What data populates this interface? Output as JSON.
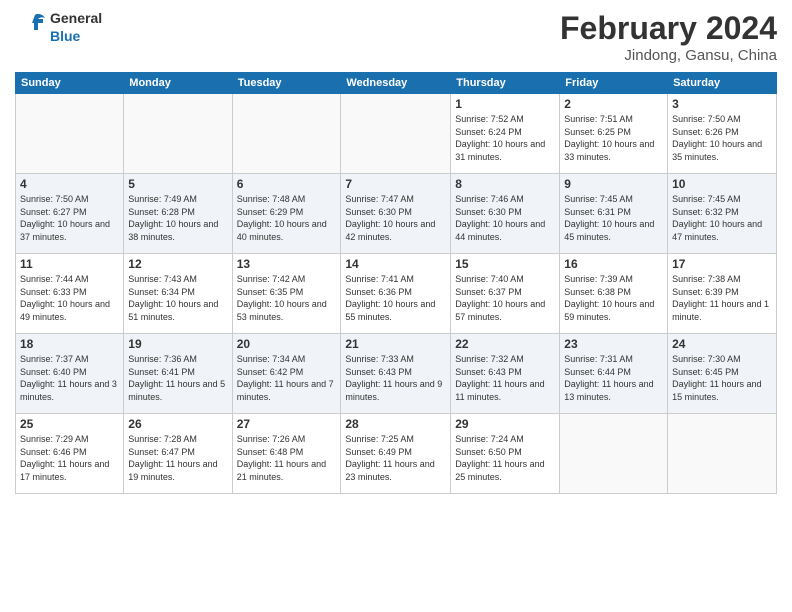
{
  "header": {
    "logo_line1": "General",
    "logo_line2": "Blue",
    "month_year": "February 2024",
    "location": "Jindong, Gansu, China"
  },
  "days_of_week": [
    "Sunday",
    "Monday",
    "Tuesday",
    "Wednesday",
    "Thursday",
    "Friday",
    "Saturday"
  ],
  "weeks": [
    [
      {
        "day": "",
        "info": ""
      },
      {
        "day": "",
        "info": ""
      },
      {
        "day": "",
        "info": ""
      },
      {
        "day": "",
        "info": ""
      },
      {
        "day": "1",
        "info": "Sunrise: 7:52 AM\nSunset: 6:24 PM\nDaylight: 10 hours and 31 minutes."
      },
      {
        "day": "2",
        "info": "Sunrise: 7:51 AM\nSunset: 6:25 PM\nDaylight: 10 hours and 33 minutes."
      },
      {
        "day": "3",
        "info": "Sunrise: 7:50 AM\nSunset: 6:26 PM\nDaylight: 10 hours and 35 minutes."
      }
    ],
    [
      {
        "day": "4",
        "info": "Sunrise: 7:50 AM\nSunset: 6:27 PM\nDaylight: 10 hours and 37 minutes."
      },
      {
        "day": "5",
        "info": "Sunrise: 7:49 AM\nSunset: 6:28 PM\nDaylight: 10 hours and 38 minutes."
      },
      {
        "day": "6",
        "info": "Sunrise: 7:48 AM\nSunset: 6:29 PM\nDaylight: 10 hours and 40 minutes."
      },
      {
        "day": "7",
        "info": "Sunrise: 7:47 AM\nSunset: 6:30 PM\nDaylight: 10 hours and 42 minutes."
      },
      {
        "day": "8",
        "info": "Sunrise: 7:46 AM\nSunset: 6:30 PM\nDaylight: 10 hours and 44 minutes."
      },
      {
        "day": "9",
        "info": "Sunrise: 7:45 AM\nSunset: 6:31 PM\nDaylight: 10 hours and 45 minutes."
      },
      {
        "day": "10",
        "info": "Sunrise: 7:45 AM\nSunset: 6:32 PM\nDaylight: 10 hours and 47 minutes."
      }
    ],
    [
      {
        "day": "11",
        "info": "Sunrise: 7:44 AM\nSunset: 6:33 PM\nDaylight: 10 hours and 49 minutes."
      },
      {
        "day": "12",
        "info": "Sunrise: 7:43 AM\nSunset: 6:34 PM\nDaylight: 10 hours and 51 minutes."
      },
      {
        "day": "13",
        "info": "Sunrise: 7:42 AM\nSunset: 6:35 PM\nDaylight: 10 hours and 53 minutes."
      },
      {
        "day": "14",
        "info": "Sunrise: 7:41 AM\nSunset: 6:36 PM\nDaylight: 10 hours and 55 minutes."
      },
      {
        "day": "15",
        "info": "Sunrise: 7:40 AM\nSunset: 6:37 PM\nDaylight: 10 hours and 57 minutes."
      },
      {
        "day": "16",
        "info": "Sunrise: 7:39 AM\nSunset: 6:38 PM\nDaylight: 10 hours and 59 minutes."
      },
      {
        "day": "17",
        "info": "Sunrise: 7:38 AM\nSunset: 6:39 PM\nDaylight: 11 hours and 1 minute."
      }
    ],
    [
      {
        "day": "18",
        "info": "Sunrise: 7:37 AM\nSunset: 6:40 PM\nDaylight: 11 hours and 3 minutes."
      },
      {
        "day": "19",
        "info": "Sunrise: 7:36 AM\nSunset: 6:41 PM\nDaylight: 11 hours and 5 minutes."
      },
      {
        "day": "20",
        "info": "Sunrise: 7:34 AM\nSunset: 6:42 PM\nDaylight: 11 hours and 7 minutes."
      },
      {
        "day": "21",
        "info": "Sunrise: 7:33 AM\nSunset: 6:43 PM\nDaylight: 11 hours and 9 minutes."
      },
      {
        "day": "22",
        "info": "Sunrise: 7:32 AM\nSunset: 6:43 PM\nDaylight: 11 hours and 11 minutes."
      },
      {
        "day": "23",
        "info": "Sunrise: 7:31 AM\nSunset: 6:44 PM\nDaylight: 11 hours and 13 minutes."
      },
      {
        "day": "24",
        "info": "Sunrise: 7:30 AM\nSunset: 6:45 PM\nDaylight: 11 hours and 15 minutes."
      }
    ],
    [
      {
        "day": "25",
        "info": "Sunrise: 7:29 AM\nSunset: 6:46 PM\nDaylight: 11 hours and 17 minutes."
      },
      {
        "day": "26",
        "info": "Sunrise: 7:28 AM\nSunset: 6:47 PM\nDaylight: 11 hours and 19 minutes."
      },
      {
        "day": "27",
        "info": "Sunrise: 7:26 AM\nSunset: 6:48 PM\nDaylight: 11 hours and 21 minutes."
      },
      {
        "day": "28",
        "info": "Sunrise: 7:25 AM\nSunset: 6:49 PM\nDaylight: 11 hours and 23 minutes."
      },
      {
        "day": "29",
        "info": "Sunrise: 7:24 AM\nSunset: 6:50 PM\nDaylight: 11 hours and 25 minutes."
      },
      {
        "day": "",
        "info": ""
      },
      {
        "day": "",
        "info": ""
      }
    ]
  ]
}
